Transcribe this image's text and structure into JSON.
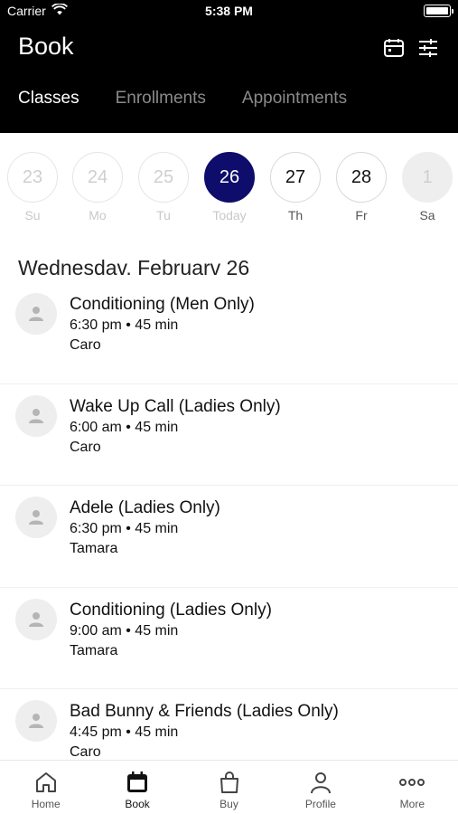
{
  "status_bar": {
    "carrier": "Carrier",
    "time": "5:38 PM"
  },
  "header": {
    "title": "Book",
    "icons": [
      "calendar-icon",
      "filter-sliders-icon"
    ]
  },
  "tabs": [
    {
      "label": "Classes",
      "active": true
    },
    {
      "label": "Enrollments",
      "active": false
    },
    {
      "label": "Appointments",
      "active": false
    }
  ],
  "date_strip": [
    {
      "num": "23",
      "label": "Su",
      "state": "past"
    },
    {
      "num": "24",
      "label": "Mo",
      "state": "past"
    },
    {
      "num": "25",
      "label": "Tu",
      "state": "past"
    },
    {
      "num": "26",
      "label": "Today",
      "state": "selected"
    },
    {
      "num": "27",
      "label": "Th",
      "state": "normal"
    },
    {
      "num": "28",
      "label": "Fr",
      "state": "normal"
    },
    {
      "num": "1",
      "label": "Sa",
      "state": "disabled"
    }
  ],
  "date_heading": "Wednesdav. Februarv 26",
  "classes": [
    {
      "name": "Conditioning (Men Only)",
      "meta": "6:30 pm • 45 min",
      "instructor": "Caro"
    },
    {
      "name": "Wake Up Call (Ladies Only)",
      "meta": "6:00 am • 45 min",
      "instructor": "Caro"
    },
    {
      "name": "Adele (Ladies Only)",
      "meta": "6:30 pm • 45 min",
      "instructor": "Tamara"
    },
    {
      "name": "Conditioning (Ladies Only)",
      "meta": "9:00 am • 45 min",
      "instructor": "Tamara"
    },
    {
      "name": "Bad Bunny & Friends (Ladies Only)",
      "meta": "4:45 pm • 45 min",
      "instructor": "Caro"
    }
  ],
  "tab_bar": [
    {
      "label": "Home",
      "icon": "home-icon",
      "active": false
    },
    {
      "label": "Book",
      "icon": "calendar-book-icon",
      "active": true
    },
    {
      "label": "Buy",
      "icon": "shopping-bag-icon",
      "active": false
    },
    {
      "label": "Profile",
      "icon": "profile-icon",
      "active": false
    },
    {
      "label": "More",
      "icon": "more-dots-icon",
      "active": false
    }
  ],
  "colors": {
    "header_bg": "#000000",
    "selected_day": "#0f0d6b"
  }
}
